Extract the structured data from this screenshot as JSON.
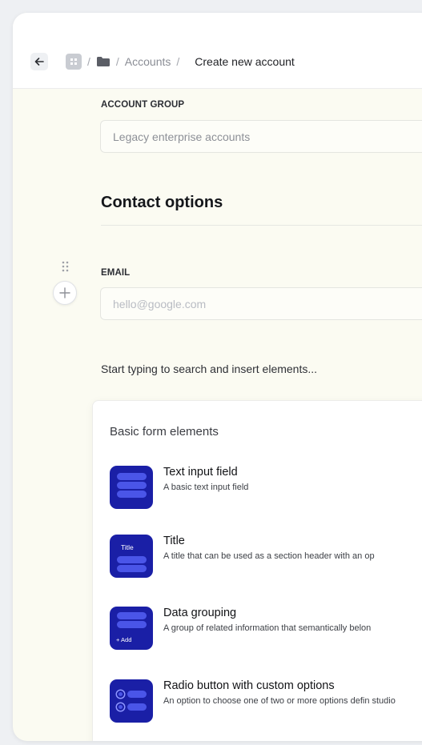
{
  "breadcrumb": {
    "link": "Accounts",
    "current": "Create new account",
    "separator": "/"
  },
  "form": {
    "account_group": {
      "label": "ACCOUNT GROUP",
      "value": "Legacy enterprise accounts"
    },
    "section_title": "Contact options",
    "email": {
      "label": "EMAIL",
      "placeholder": "hello@google.com"
    },
    "insert_hint": "Start typing to search and insert elements..."
  },
  "palette": {
    "title": "Basic form elements",
    "items": [
      {
        "title": "Text input field",
        "description": "A basic text input field",
        "icon": "text-input-icon"
      },
      {
        "title": "Title",
        "description": "A title that can be used as a section header with an op",
        "icon": "title-icon",
        "icon_label": "Title"
      },
      {
        "title": "Data grouping",
        "description": "A group of related information that semantically belon",
        "icon": "data-grouping-icon",
        "icon_label": "+ Add"
      },
      {
        "title": "Radio button with custom options",
        "description": "An option to choose one of two or more options defin studio",
        "icon": "radio-icon"
      }
    ]
  },
  "colors": {
    "accent": "#1a1fa6",
    "accent_light": "#4a55e8",
    "background": "#fbfbf2"
  }
}
